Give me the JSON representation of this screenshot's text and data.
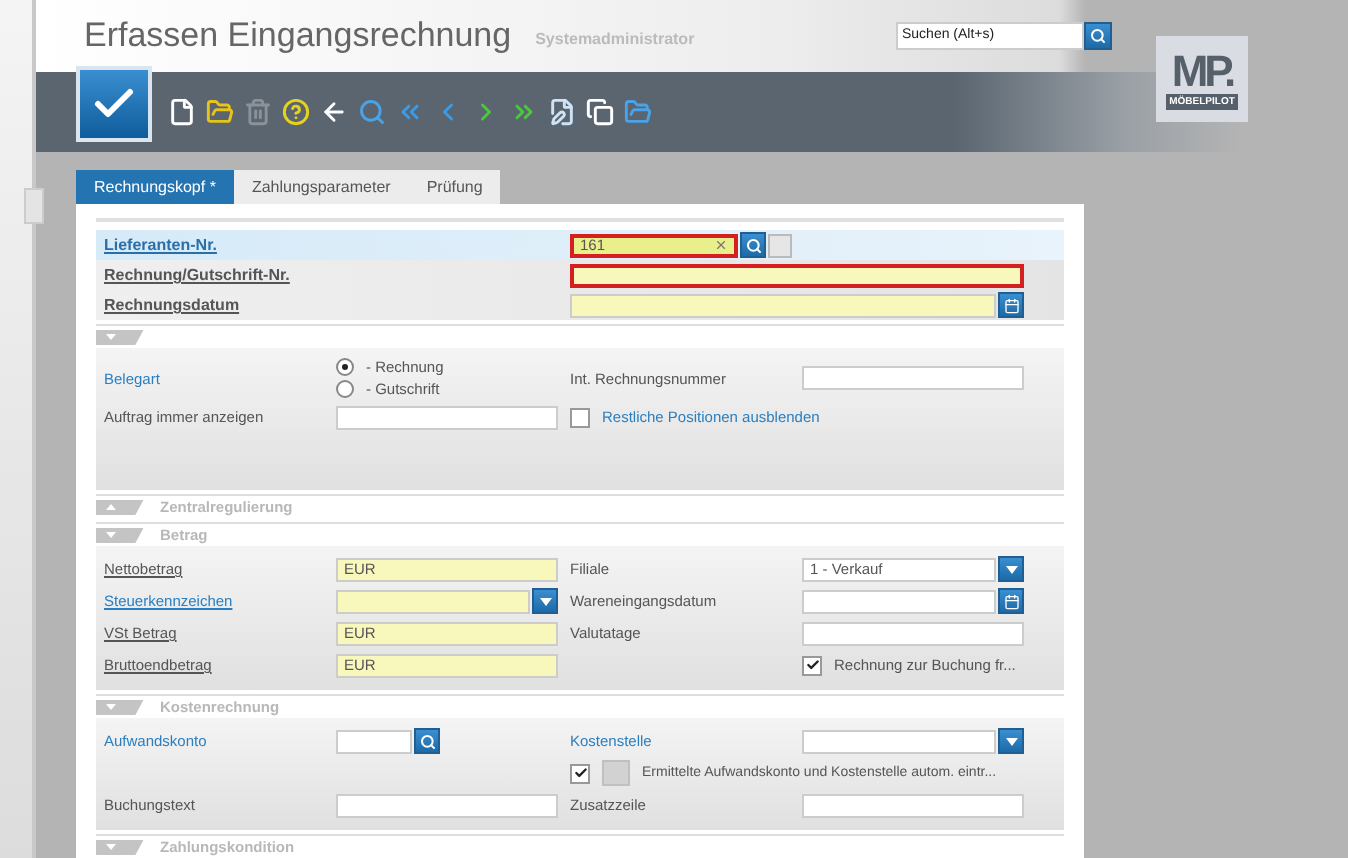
{
  "window": {
    "title": "Erfassen Eingangsrechnung",
    "user": "Systemadministrator"
  },
  "search": {
    "placeholder": "Suchen (Alt+s)"
  },
  "logo": {
    "mark": "MP.",
    "name": "MÖBELPILOT"
  },
  "tabs": [
    {
      "label": "Rechnungskopf *",
      "selected": true
    },
    {
      "label": "Zahlungsparameter",
      "selected": false
    },
    {
      "label": "Prüfung",
      "selected": false
    }
  ],
  "header_fields": [
    {
      "label": "Lieferanten-Nr.",
      "value": "161",
      "kind": "lookup",
      "focused": true,
      "error": true
    },
    {
      "label": "Rechnung/Gutschrift-Nr.",
      "kind": "text",
      "focused": false,
      "error": true
    },
    {
      "label": "Rechnungsdatum",
      "kind": "date",
      "focused": false,
      "error": false
    }
  ],
  "sections": [
    {
      "expanded": true,
      "rows": [
        [
          {
            "kind": "label",
            "text": "Belegart",
            "link": true,
            "underlined": false
          },
          {
            "kind": "radios",
            "options": [
              {
                "label": "- Rechnung",
                "selected": true
              },
              {
                "label": "- Gutschrift",
                "selected": false
              }
            ]
          },
          {
            "kind": "label",
            "text": "Int. Rechnungsnummer",
            "link": false,
            "underlined": false
          },
          {
            "kind": "field"
          }
        ],
        [
          {
            "kind": "label",
            "text": "Auftrag immer anzeigen",
            "link": false,
            "underlined": false
          },
          {
            "kind": "field"
          },
          {
            "kind": "checkbox",
            "label": "Restliche Positionen ausblenden",
            "checked": false,
            "link": true
          }
        ]
      ]
    },
    {
      "title": "Zentralregulierung",
      "expanded": false
    },
    {
      "title": "Betrag",
      "expanded": true,
      "rows": [
        [
          {
            "kind": "label",
            "text": "Nettobetrag",
            "link": false,
            "underlined": true
          },
          {
            "kind": "field",
            "value": "EUR",
            "required": true
          },
          {
            "kind": "label",
            "text": "Filiale",
            "link": false,
            "underlined": false
          },
          {
            "kind": "field",
            "value": "1 - Verkauf",
            "button": {
              "kind": "dropdown"
            }
          }
        ],
        [
          {
            "kind": "label",
            "text": "Steuerkennzeichen",
            "link": true,
            "underlined": true
          },
          {
            "kind": "field",
            "required": true,
            "button": {
              "kind": "dropdown"
            }
          },
          {
            "kind": "label",
            "text": "Wareneingangsdatum",
            "link": false,
            "underlined": false
          },
          {
            "kind": "field",
            "button": {
              "kind": "date"
            }
          }
        ],
        [
          {
            "kind": "label",
            "text": "VSt Betrag",
            "link": false,
            "underlined": true
          },
          {
            "kind": "field",
            "value": "EUR",
            "required": true
          },
          {
            "kind": "label",
            "text": "Valutatage",
            "link": false,
            "underlined": false
          },
          {
            "kind": "field"
          }
        ],
        [
          {
            "kind": "label",
            "text": "Bruttoendbetrag",
            "link": false,
            "underlined": true
          },
          {
            "kind": "field",
            "value": "EUR",
            "required": true
          },
          {
            "kind": "empty"
          },
          {
            "kind": "checkbox",
            "label": "Rechnung zur Buchung fr...",
            "checked": true,
            "link": false
          }
        ]
      ]
    },
    {
      "title": "Kostenrechnung",
      "expanded": true,
      "rows": [
        [
          {
            "kind": "label",
            "text": "Aufwandskonto",
            "link": true,
            "underlined": false
          },
          {
            "kind": "field",
            "button": {
              "kind": "lookup"
            },
            "short": true
          },
          {
            "kind": "label",
            "text": "Kostenstelle",
            "link": true,
            "underlined": false
          },
          {
            "kind": "field",
            "button": {
              "kind": "dropdown"
            }
          }
        ],
        [
          {
            "kind": "empty"
          },
          {
            "kind": "empty"
          },
          {
            "kind": "checkbox",
            "label": "Ermittelte Aufwandskonto und Kostenstelle autom. eintr...",
            "checked": true,
            "link": false,
            "icon": true
          }
        ],
        [
          {
            "kind": "label",
            "text": "Buchungstext",
            "link": false,
            "underlined": false
          },
          {
            "kind": "field"
          },
          {
            "kind": "label",
            "text": "Zusatzzeile",
            "link": false,
            "underlined": false
          },
          {
            "kind": "field"
          }
        ]
      ]
    },
    {
      "title": "Zahlungskondition",
      "expanded": true
    }
  ]
}
